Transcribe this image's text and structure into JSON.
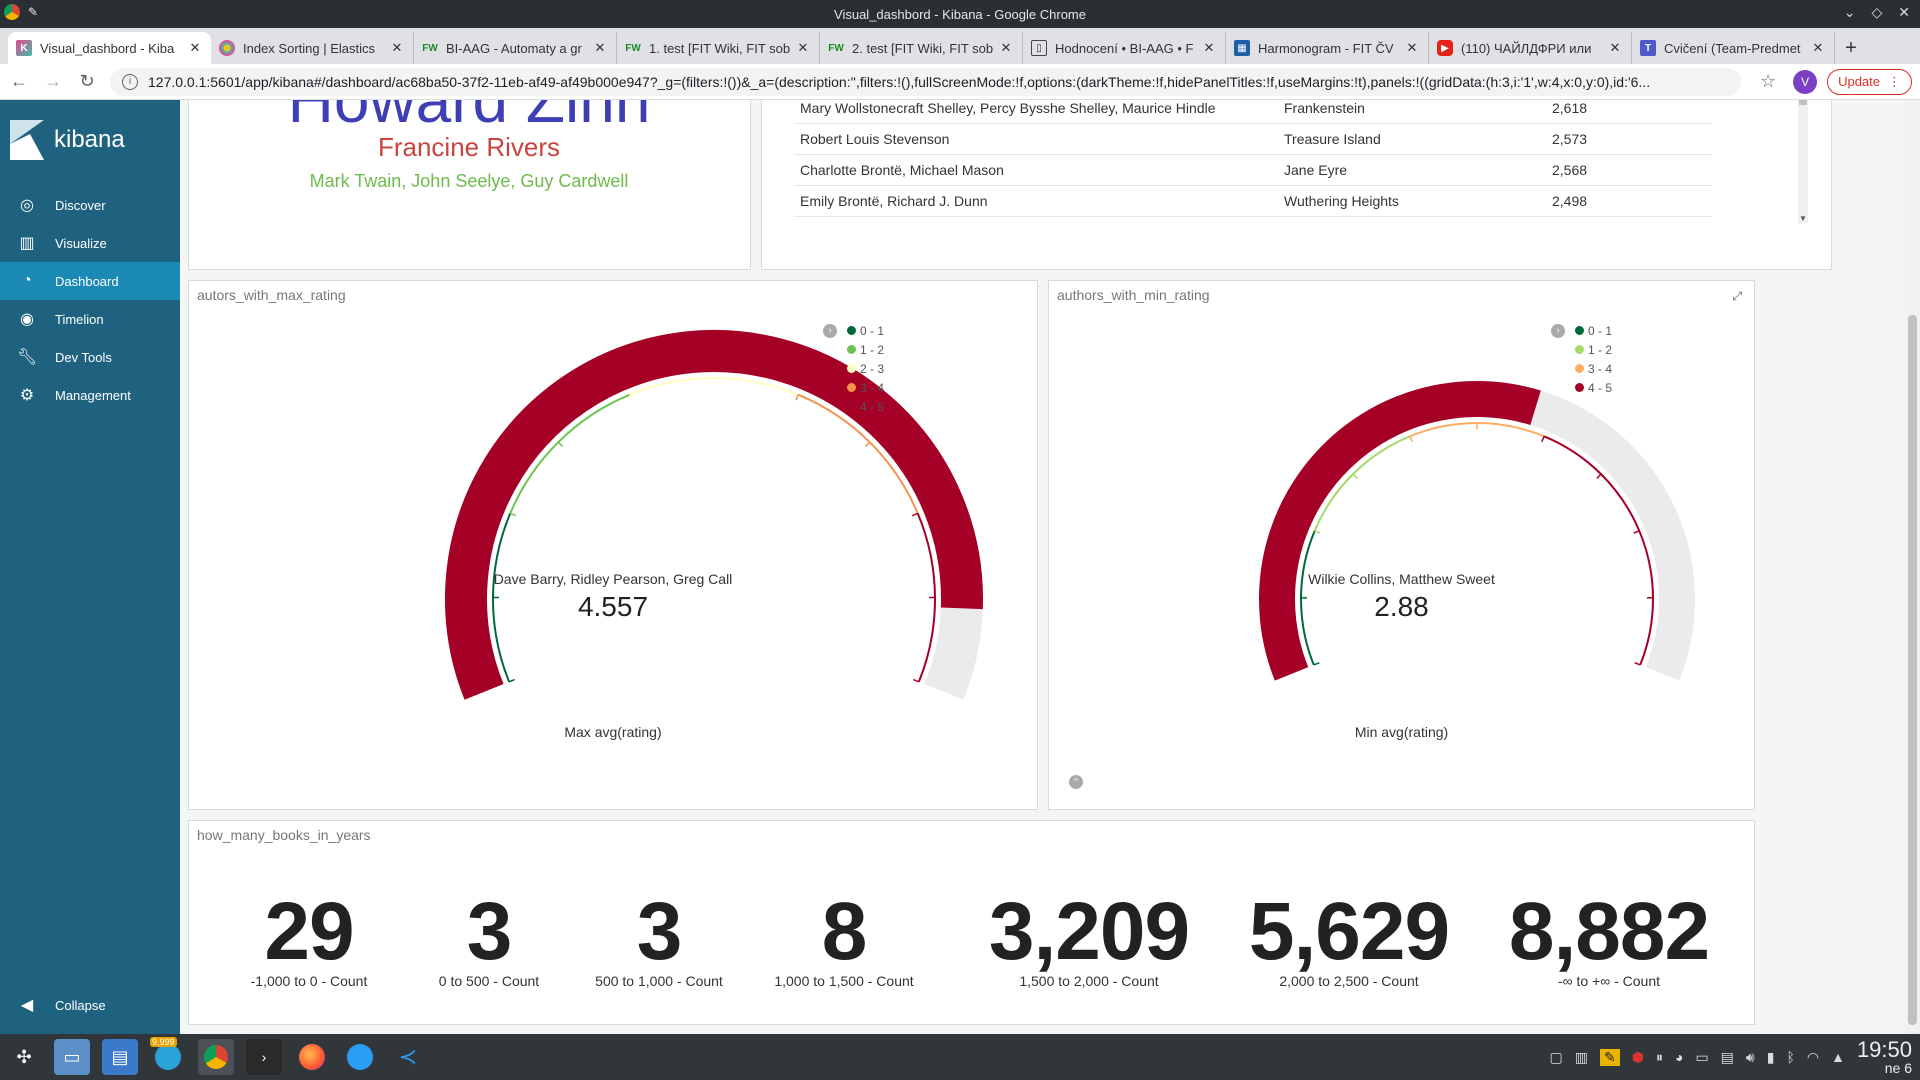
{
  "window": {
    "title": "Visual_dashbord - Kibana - Google Chrome"
  },
  "tabs": [
    {
      "label": "Visual_dashbord - Kiba",
      "icon": "kibana-icon",
      "active": true
    },
    {
      "label": "Index Sorting | Elastics",
      "icon": "elastic-icon"
    },
    {
      "label": "BI-AAG - Automaty a gr",
      "icon": "fw-icon"
    },
    {
      "label": "1. test [FIT Wiki, FIT sob",
      "icon": "fw-icon"
    },
    {
      "label": "2. test [FIT Wiki, FIT sob",
      "icon": "fw-icon"
    },
    {
      "label": "Hodnocení • BI-AAG • F",
      "icon": "book-icon"
    },
    {
      "label": "Harmonogram - FIT ČV",
      "icon": "calendar-icon"
    },
    {
      "label": "(110) ЧАЙЛДФРИ или",
      "icon": "youtube-icon"
    },
    {
      "label": "Cvičení (Team-Predmet",
      "icon": "teams-icon"
    }
  ],
  "addressbar": {
    "url": "127.0.0.1:5601/app/kibana#/dashboard/ac68ba50-37f2-11eb-af49-af49b000e947?_g=(filters:!())&_a=(description:'',filters:!(),fullScreenMode:!f,options:(darkTheme:!f,hidePanelTitles:!f,useMargins:!t),panels:!((gridData:(h:3,i:'1',w:4,x:0,y:0),id:'6...",
    "avatar": "V",
    "update_label": "Update"
  },
  "sidebar": {
    "brand": "kibana",
    "items": [
      {
        "label": "Discover",
        "icon": "compass-icon"
      },
      {
        "label": "Visualize",
        "icon": "bar-chart-icon"
      },
      {
        "label": "Dashboard",
        "icon": "dashboard-icon",
        "active": true
      },
      {
        "label": "Timelion",
        "icon": "timelion-icon"
      },
      {
        "label": "Dev Tools",
        "icon": "wrench-icon"
      },
      {
        "label": "Management",
        "icon": "gear-icon"
      }
    ],
    "collapse_label": "Collapse"
  },
  "text_panel": {
    "top_name": "Howard Zinn",
    "second_name": "Francine Rivers",
    "third_name": "Mark Twain, John Seelye, Guy Cardwell",
    "colors": {
      "top": "#3f3fb5",
      "second": "#c8453f",
      "third": "#6dbb4c"
    }
  },
  "table_panel": {
    "rows": [
      {
        "author": "Mary Wollstonecraft Shelley, Percy Bysshe Shelley, Maurice Hindle",
        "title": "Frankenstein",
        "count": "2,618"
      },
      {
        "author": "Robert Louis Stevenson",
        "title": "Treasure Island",
        "count": "2,573"
      },
      {
        "author": "Charlotte Brontë, Michael Mason",
        "title": "Jane Eyre",
        "count": "2,568"
      },
      {
        "author": "Emily Brontë, Richard J. Dunn",
        "title": "Wuthering Heights",
        "count": "2,498"
      }
    ]
  },
  "gauges": [
    {
      "title": "autors_with_max_rating",
      "label": "Dave Barry, Ridley Pearson, Greg Call",
      "value": "4.557",
      "value_num": 4.557,
      "sub": "Max avg(rating)",
      "legend": [
        {
          "label": "0 - 1",
          "color": "#006837"
        },
        {
          "label": "1 - 2",
          "color": "#6cc451"
        },
        {
          "label": "2 - 3",
          "color": "#ffffbf"
        },
        {
          "label": "3 - 4",
          "color": "#f4944f"
        },
        {
          "label": "4 - 5",
          "color": "#a50026"
        }
      ]
    },
    {
      "title": "authors_with_min_rating",
      "label": "Wilkie Collins, Matthew Sweet",
      "value": "2.88",
      "value_num": 2.88,
      "sub": "Min avg(rating)",
      "legend": [
        {
          "label": "0 - 1",
          "color": "#006837"
        },
        {
          "label": "1 - 2",
          "color": "#a6d96a"
        },
        {
          "label": "3 - 4",
          "color": "#fdae61"
        },
        {
          "label": "4 - 5",
          "color": "#a50026"
        }
      ]
    }
  ],
  "metrics_panel": {
    "title": "how_many_books_in_years",
    "items": [
      {
        "value": "29",
        "label": "-1,000 to 0 - Count"
      },
      {
        "value": "3",
        "label": "0 to 500 - Count"
      },
      {
        "value": "3",
        "label": "500 to 1,000 - Count"
      },
      {
        "value": "8",
        "label": "1,000 to 1,500 - Count"
      },
      {
        "value": "3,209",
        "label": "1,500 to 2,000 - Count"
      },
      {
        "value": "5,629",
        "label": "2,000 to 2,500 - Count"
      },
      {
        "value": "8,882",
        "label": "-∞ to +∞ - Count"
      }
    ]
  },
  "taskbar": {
    "badge": "9,999",
    "clock_time": "19:50",
    "clock_day": "ne 6"
  }
}
